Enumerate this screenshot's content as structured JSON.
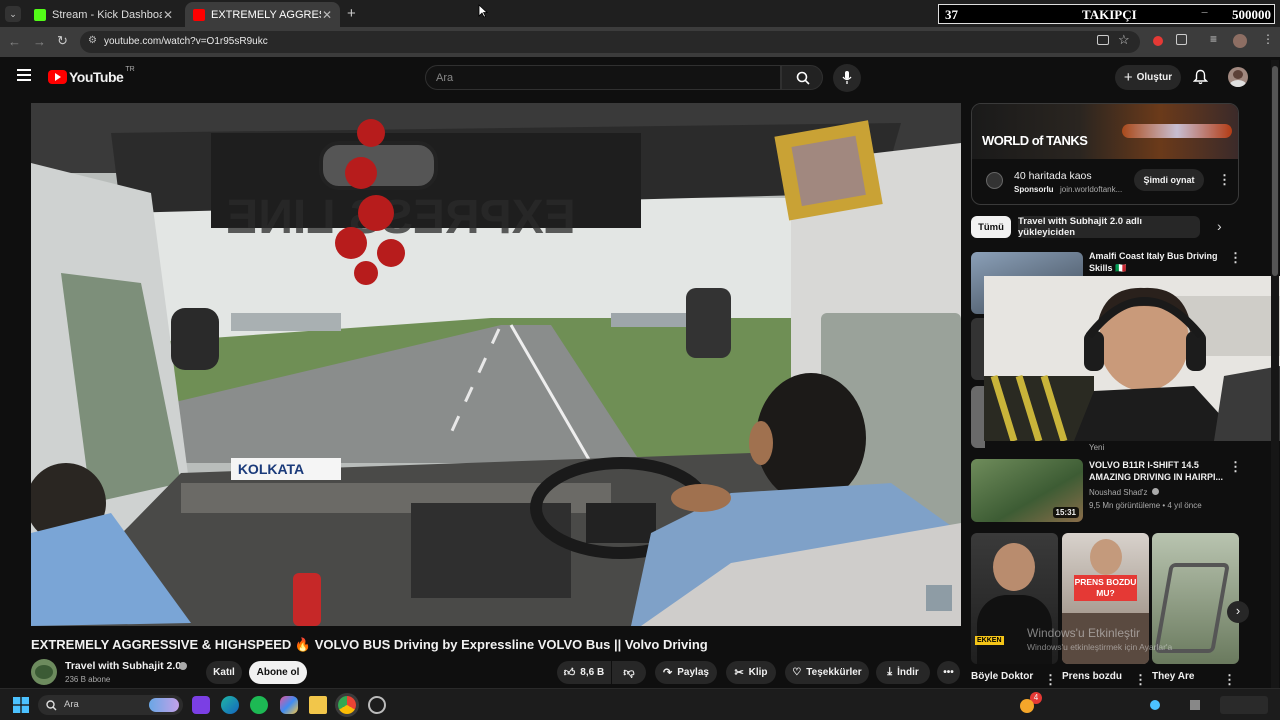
{
  "browser": {
    "tabs": [
      {
        "title": "Stream - Kick Dashboard",
        "active": false,
        "favicon_color": "#53fc18"
      },
      {
        "title": "EXTREMELY AGGRESSIVE & HIGHSPEED",
        "active": true,
        "favicon_color": "#ff0000"
      }
    ],
    "new_tab_label": "+",
    "url": "youtube.com/watch?v=O1r95sR9ukc"
  },
  "stream_overlay": {
    "count": "37",
    "label": "TAKIPÇI",
    "minus": "−",
    "goal": "500000"
  },
  "youtube": {
    "logo_text": "YouTube",
    "region": "TR",
    "search_placeholder": "Ara",
    "create_label": "Oluştur",
    "video": {
      "title": "EXTREMELY AGGRESSIVE & HIGHSPEED 🔥 VOLVO BUS Driving by Expressline VOLVO Bus || Volvo Driving",
      "dash_sign": "KOLKATA",
      "header_sign": "EXPRESS LINE"
    },
    "channel": {
      "name": "Travel with Subhajit 2.0",
      "subscribers": "236 B abone",
      "join_label": "Katıl",
      "subscribe_label": "Abone ol"
    },
    "actions": {
      "likes": "8,6 B",
      "share": "Paylaş",
      "clip": "Klip",
      "thanks": "Teşekkürler",
      "download": "İndir",
      "more": "•••"
    },
    "ad": {
      "banner_title": "WORLD of TANKS",
      "headline": "40 haritada kaos",
      "sponsored": "Sponsorlu",
      "domain": "join.worldoftank...",
      "cta": "Şimdi oynat"
    },
    "chips": [
      {
        "label": "Tümü",
        "active": true
      },
      {
        "label": "Travel with Subhajit 2.0 adlı yükleyiciden",
        "active": false
      }
    ],
    "recommendations": [
      {
        "title_line1": "Amalfi Coast Italy Bus Driving",
        "title_line2": "Skills 🇮🇹",
        "channel": "",
        "meta": "",
        "duration": ""
      },
      {
        "title_line1": "VOLVO B11R I-SHIFT 14.5",
        "title_line2": "AMAZING DRIVING IN HAIRPI...",
        "channel": "Noushad Shad'z",
        "meta": "9,5 Mn görüntüleme • 4 yıl önce",
        "duration": "15:31",
        "badge": "Yeni"
      }
    ],
    "shorts": [
      {
        "title": "Böyle Doktor",
        "overlay": "EKKEN"
      },
      {
        "title": "Prens bozdu",
        "overlay": "PRENS BOZDU MU?"
      },
      {
        "title": "They Are",
        "overlay": ""
      }
    ]
  },
  "windows_watermark": {
    "line1": "Windows'u Etkinleştir",
    "line2": "Windows'u etkinleştirmek için Ayarlar'a"
  },
  "taskbar": {
    "search_placeholder": "Ara",
    "notification_count": "4"
  },
  "colors": {
    "youtube_red": "#ff0000",
    "background": "#0f0f0f",
    "kick_green": "#53fc18"
  }
}
